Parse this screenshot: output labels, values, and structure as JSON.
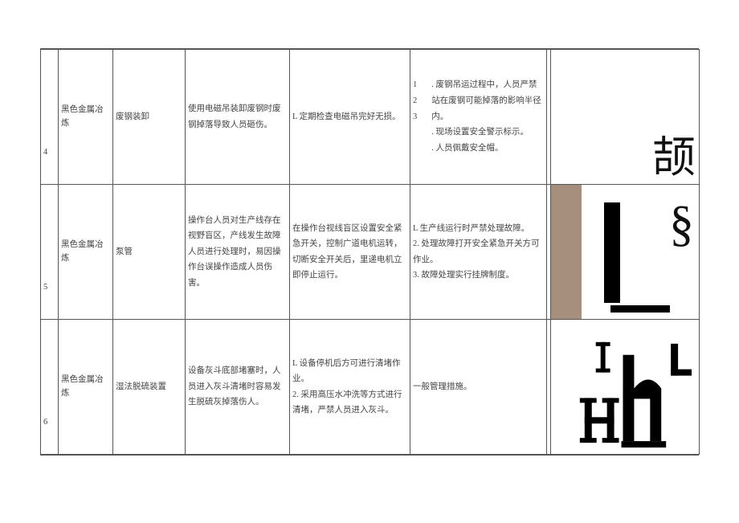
{
  "rows": [
    {
      "idx": "4",
      "category": "黑色金属冶炼",
      "point": "废钢装卸",
      "risk": "使用电磁吊装卸废钢时废钢掉落导致人员砸伤。",
      "measure": "L 定期检查电磁吊完好无损。",
      "mgmt_nums": [
        "1",
        "2",
        "3"
      ],
      "mgmt_texts": [
        ". 废钢吊运过程中，人员严禁站在废钢可能掉落的影响半径内。",
        ". 现场设置安全警示标示。",
        ". 人员佩戴安全帽。"
      ],
      "fig_char": "颉"
    },
    {
      "idx": "5",
      "category": "黑色金属冶炼",
      "point": "泵管",
      "risk": "操作台人员对生产线存在视野盲区，产线发生故障人员进行处理时，易因操作台误操作造成人员伤害。",
      "measure": "在操作台视线盲区设置安全紧急开关，控制广道电机运转，切断安全开关后，里递电机立即停止运行。",
      "mgmt": "L 生产线运行时严禁处理故障。\n2. 处理故障打开安全紧急开关方可作业。\n3. 故障处理实行挂牌制度。",
      "fig_section": "§"
    },
    {
      "idx": "6",
      "category": "黑色金属冶炼",
      "point": "湿法脱硫装置",
      "risk": "设备灰斗底部堵塞时，人员进入灰斗清堵时容易发生脱硫灰掉落伤人。",
      "measure": "L 设备停机后方可进行清堵作业。\n2. 采用高压水冲洗等方式进行清堵，严禁人员进入灰斗。",
      "mgmt": "一般管理措施。"
    }
  ]
}
